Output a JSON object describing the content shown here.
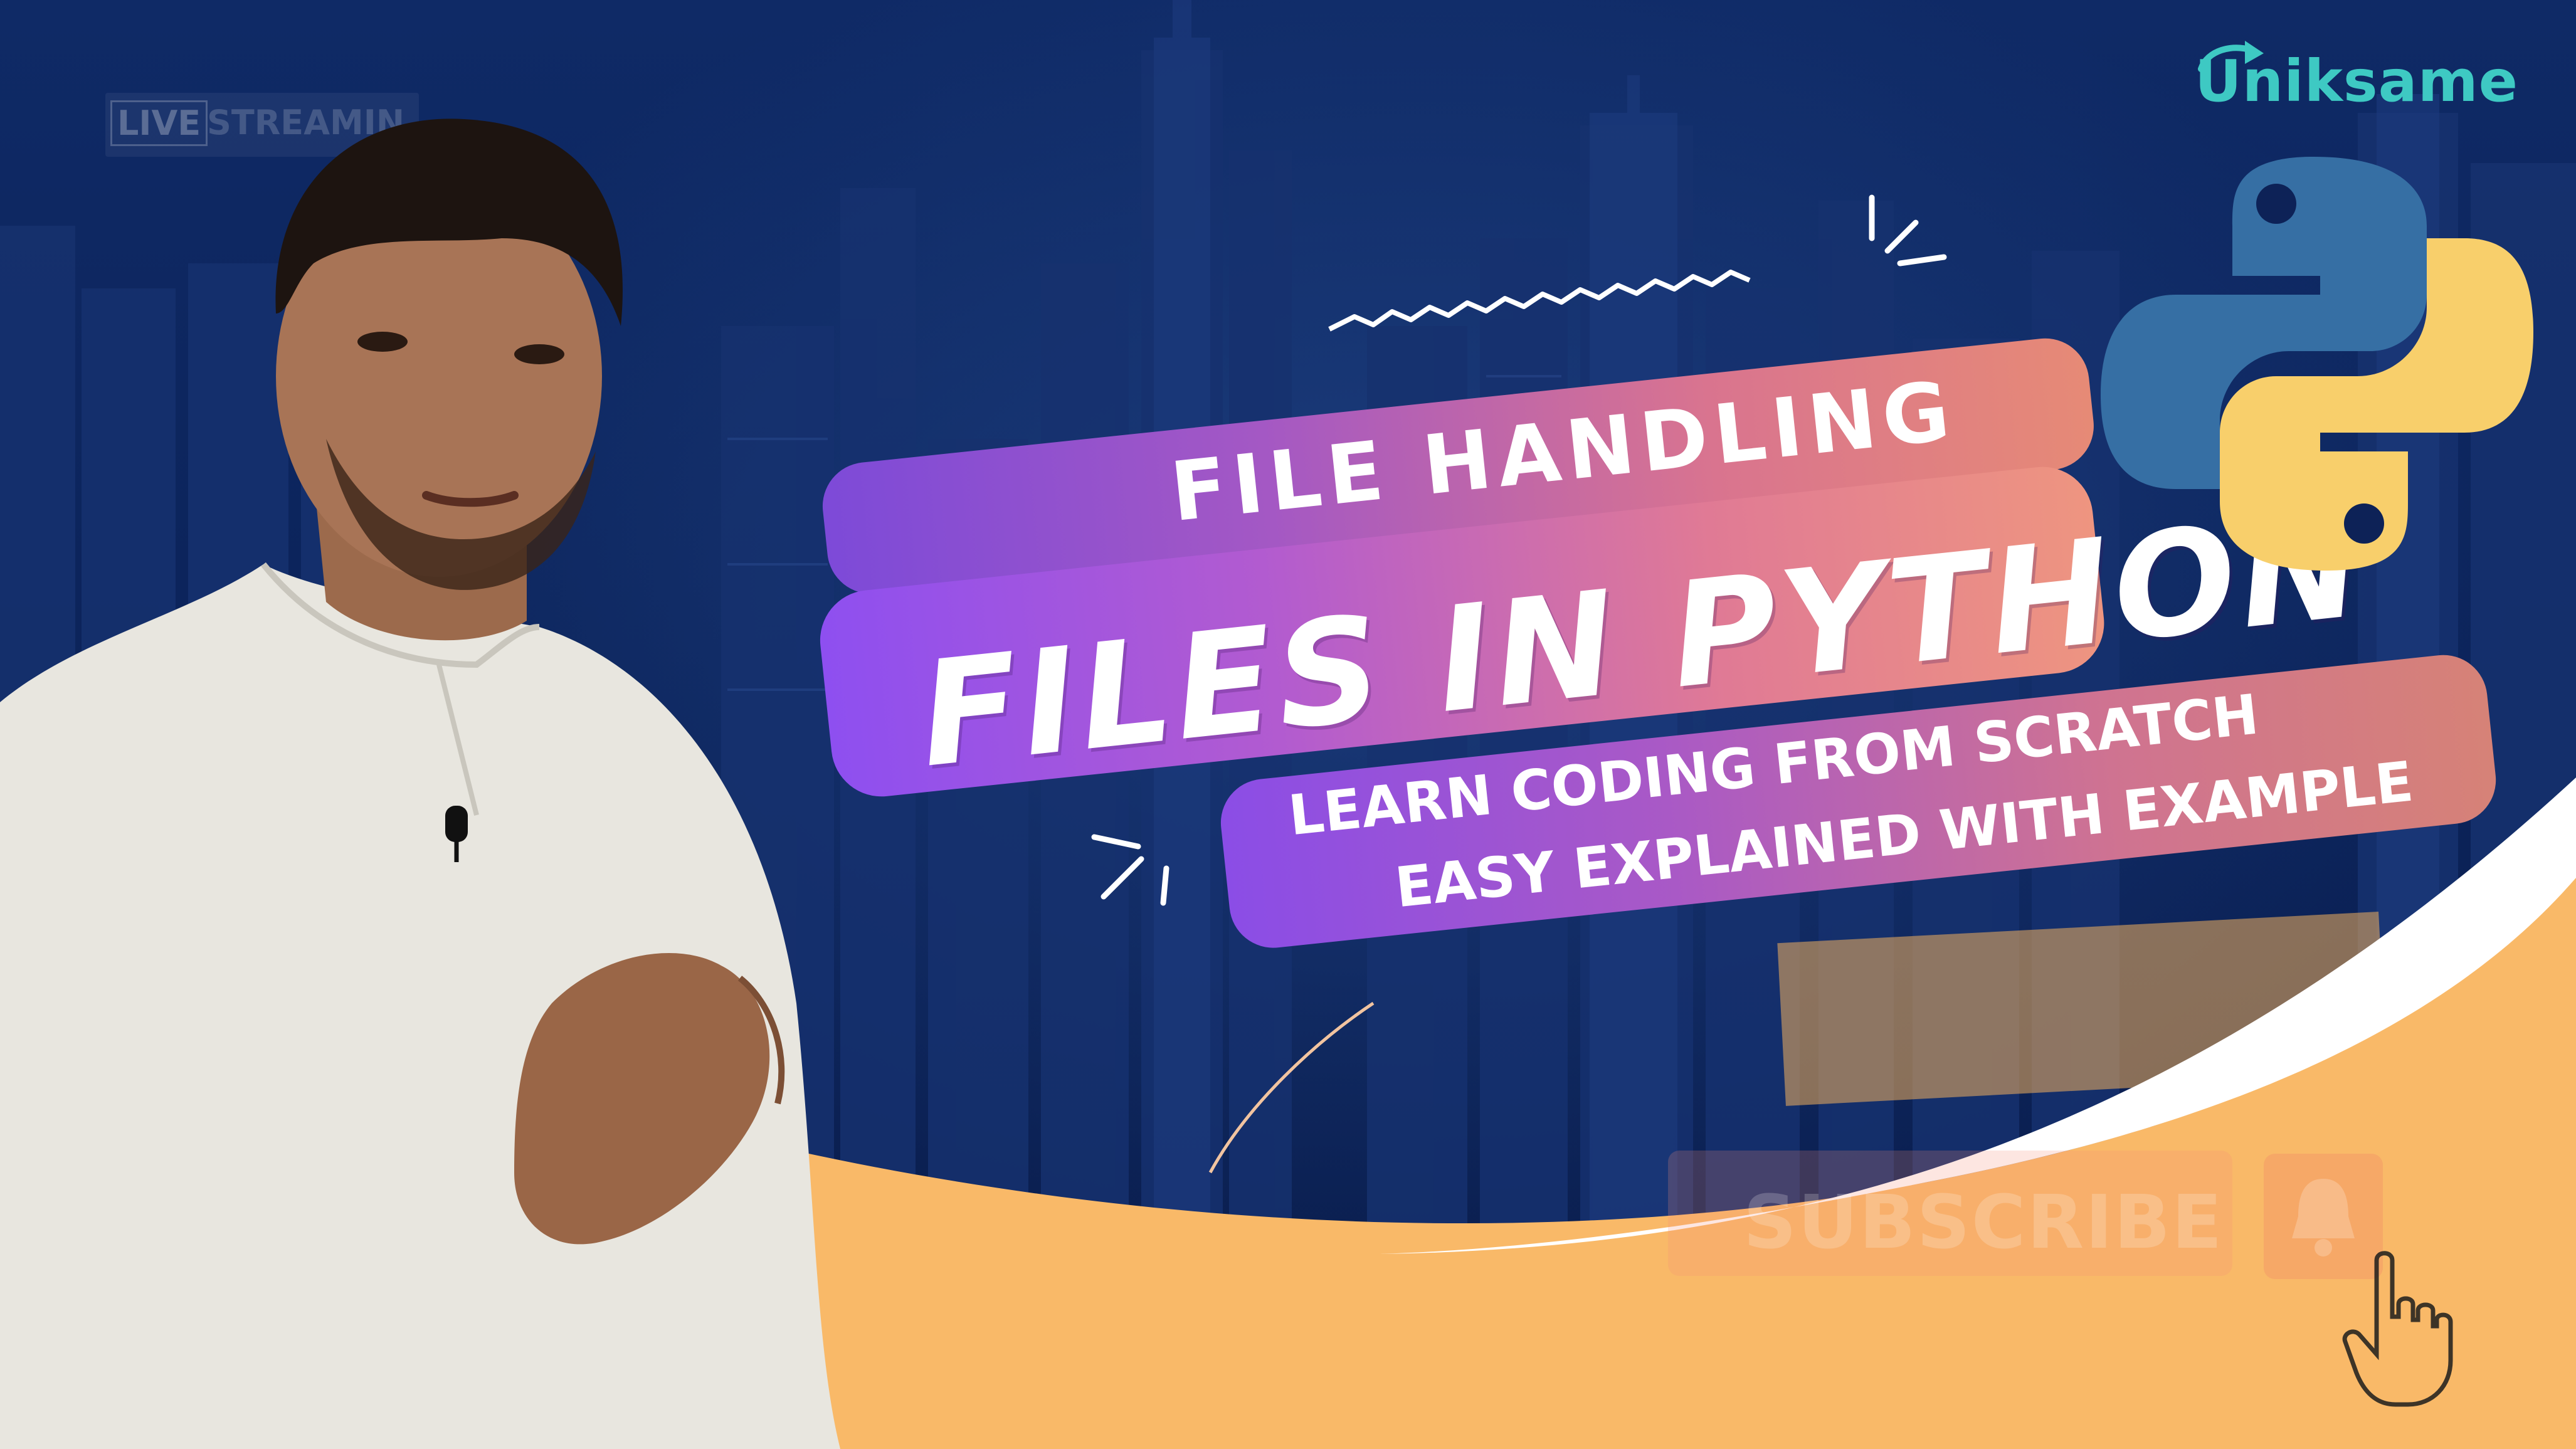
{
  "brand": {
    "logo_text": "Uniksame"
  },
  "ghost_overlay": {
    "live_label": "LIVE",
    "streaming_label": "STREAMIN"
  },
  "title": {
    "top_line": "FILE HANDLING",
    "main_line": "FILES IN PYTHON",
    "subtitle_line_1": "LEARN CODING FROM SCRATCH",
    "subtitle_line_2": "EASY EXPLAINED WITH EXAMPLE"
  },
  "subscribe": {
    "label": "SUBSCRIBE"
  },
  "icons": [
    "python-logo-icon",
    "bell-icon",
    "pointing-hand-icon",
    "play-arrow-icon",
    "microphone-icon"
  ],
  "colors": {
    "background": "#0d2257",
    "banner_start": "#8e4ff0",
    "banner_end": "#ee9580",
    "accent_orange": "#f9b968",
    "brand_teal": "#3ec9c3",
    "python_blue": "#366fa4",
    "python_yellow": "#f8cf6b"
  }
}
